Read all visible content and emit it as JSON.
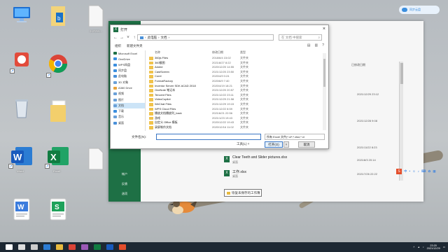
{
  "desktop": {
    "icons": [
      {
        "label": "",
        "icon": "computer-icon"
      },
      {
        "label": "",
        "icon": "document-bookmark-icon"
      },
      {
        "label": "2.27ZYI...",
        "icon": "blank-file-icon"
      },
      {
        "label": "",
        "icon": "app-icon"
      },
      {
        "label": "",
        "icon": "chrome-icon"
      },
      {
        "label": "",
        "icon": "network-icon"
      },
      {
        "label": "",
        "icon": "folder-icon"
      },
      {
        "label": "",
        "icon": "recycle-bin-icon"
      },
      {
        "label": "",
        "icon": "blank-file-icon"
      },
      {
        "label": "",
        "icon": "folder-icon"
      },
      {
        "label": "Word",
        "icon": "word-icon"
      },
      {
        "label": "Excel",
        "icon": "excel-icon"
      },
      {
        "label": "",
        "icon": "excel-file-icon"
      },
      {
        "label": "",
        "icon": "wps-writer-icon"
      },
      {
        "label": "",
        "icon": "wps-spreadsheet-icon"
      }
    ],
    "cloud_badge": "同步云盘"
  },
  "excel": {
    "rail_items": [
      "帐户",
      "反馈",
      "选项"
    ],
    "header_col": "已修改日期",
    "files": [
      {
        "name": "",
        "path": "",
        "date": "2021/12/29 23:12"
      },
      {
        "name": "",
        "path": "",
        "date": "2021/12/28 9:08"
      },
      {
        "name": "",
        "path": "",
        "date": "2021/11/22 8:23"
      },
      {
        "name": "Clear Teeth and Slider pictures.xlsx",
        "path": "桌面",
        "date": "2021/8/3 20:14"
      },
      {
        "name": "工作.xlsx",
        "path": "桌面",
        "date": "2021/7/26 22:22"
      }
    ],
    "recover_label": "恢复未保存的工作簿"
  },
  "dialog": {
    "title": "打开",
    "path": [
      "此电脑",
      "文档"
    ],
    "search_placeholder": "在 文档 中搜索",
    "organize": "组织",
    "new_folder": "新建文件夹",
    "nav_items": [
      {
        "label": "Microsoft Excel",
        "color": "#1e7045"
      },
      {
        "label": "OneDrive",
        "color": "#3b8ede"
      },
      {
        "label": "WPS网盘",
        "color": "#3b8ede"
      },
      {
        "label": "同步盘",
        "color": "#3b8ede"
      },
      {
        "label": "此电脑",
        "color": "#4a90d9"
      },
      {
        "label": "3D 对象",
        "color": "#6aa0d8"
      },
      {
        "label": "A360 Drive",
        "color": "#e8a33c"
      },
      {
        "label": "视频",
        "color": "#6aa0d8"
      },
      {
        "label": "图片",
        "color": "#6aa0d8"
      },
      {
        "label": "文档",
        "color": "#6aa0d8",
        "selected": true
      },
      {
        "label": "下载",
        "color": "#3b8ede"
      },
      {
        "label": "音乐",
        "color": "#6aa0d8"
      },
      {
        "label": "桌面",
        "color": "#4a90d9"
      }
    ],
    "columns": [
      "名称",
      "修改日期",
      "类型"
    ],
    "folders": [
      {
        "name": "360js Files",
        "date": "2018/6/4 15:02",
        "type": "文件夹"
      },
      {
        "name": "360截图",
        "date": "2021/8/27 8:22",
        "type": "文件夹"
      },
      {
        "name": "Adobe",
        "date": "2020/12/20 14:55",
        "type": "文件夹"
      },
      {
        "name": "CastScreen",
        "date": "2021/12/20 23:50",
        "type": "文件夹"
      },
      {
        "name": "Corel",
        "date": "2020/4/9 0:24",
        "type": "文件夹"
      },
      {
        "name": "FormatFactory",
        "date": "2020/6/9 7:40",
        "type": "文件夹"
      },
      {
        "name": "Inventor Server SDK ACAD 2018",
        "date": "2020/4/19 18:21",
        "type": "文件夹"
      },
      {
        "name": "OneNote 笔记本",
        "date": "2021/12/20 20:57",
        "type": "文件夹"
      },
      {
        "name": "Tencent Files",
        "date": "2021/12/22 23:11",
        "type": "文件夹"
      },
      {
        "name": "VideoCopilot",
        "date": "2021/12/29 21:58",
        "type": "文件夹"
      },
      {
        "name": "WeChat Files",
        "date": "2021/12/29 19:15",
        "type": "文件夹"
      },
      {
        "name": "WPS Cloud Files",
        "date": "2021/12/22 8:59",
        "type": "文件夹"
      },
      {
        "name": "播放文档播放列_back",
        "date": "2021/6/21 22:56",
        "type": "文件夹"
      },
      {
        "name": "游戏",
        "date": "2021/1/23 19:43",
        "type": "文件夹"
      },
      {
        "name": "自定义 Office 模板",
        "date": "2020/12/22 19:43",
        "type": "文件夹"
      },
      {
        "name": "录屏制作文档",
        "date": "2020/12/16 11:02",
        "type": "文件夹"
      }
    ],
    "filename_label": "文件名(N):",
    "filename_value": "",
    "filetype": "所有 Excel 文件(*.xl*;*.xlsx;*.xl",
    "tools": "工具(L)",
    "open": "打开(O)",
    "cancel": "取消"
  },
  "ime": {
    "label": "中"
  },
  "taskbar": {
    "time": "23:20",
    "date": "2021/12/29",
    "icons": [
      "start-icon",
      "search-icon",
      "taskview-icon",
      "edge-icon",
      "explorer-icon",
      "chrome-icon",
      "app-icon",
      "excel-icon",
      "word-icon",
      "wps-icon"
    ]
  }
}
